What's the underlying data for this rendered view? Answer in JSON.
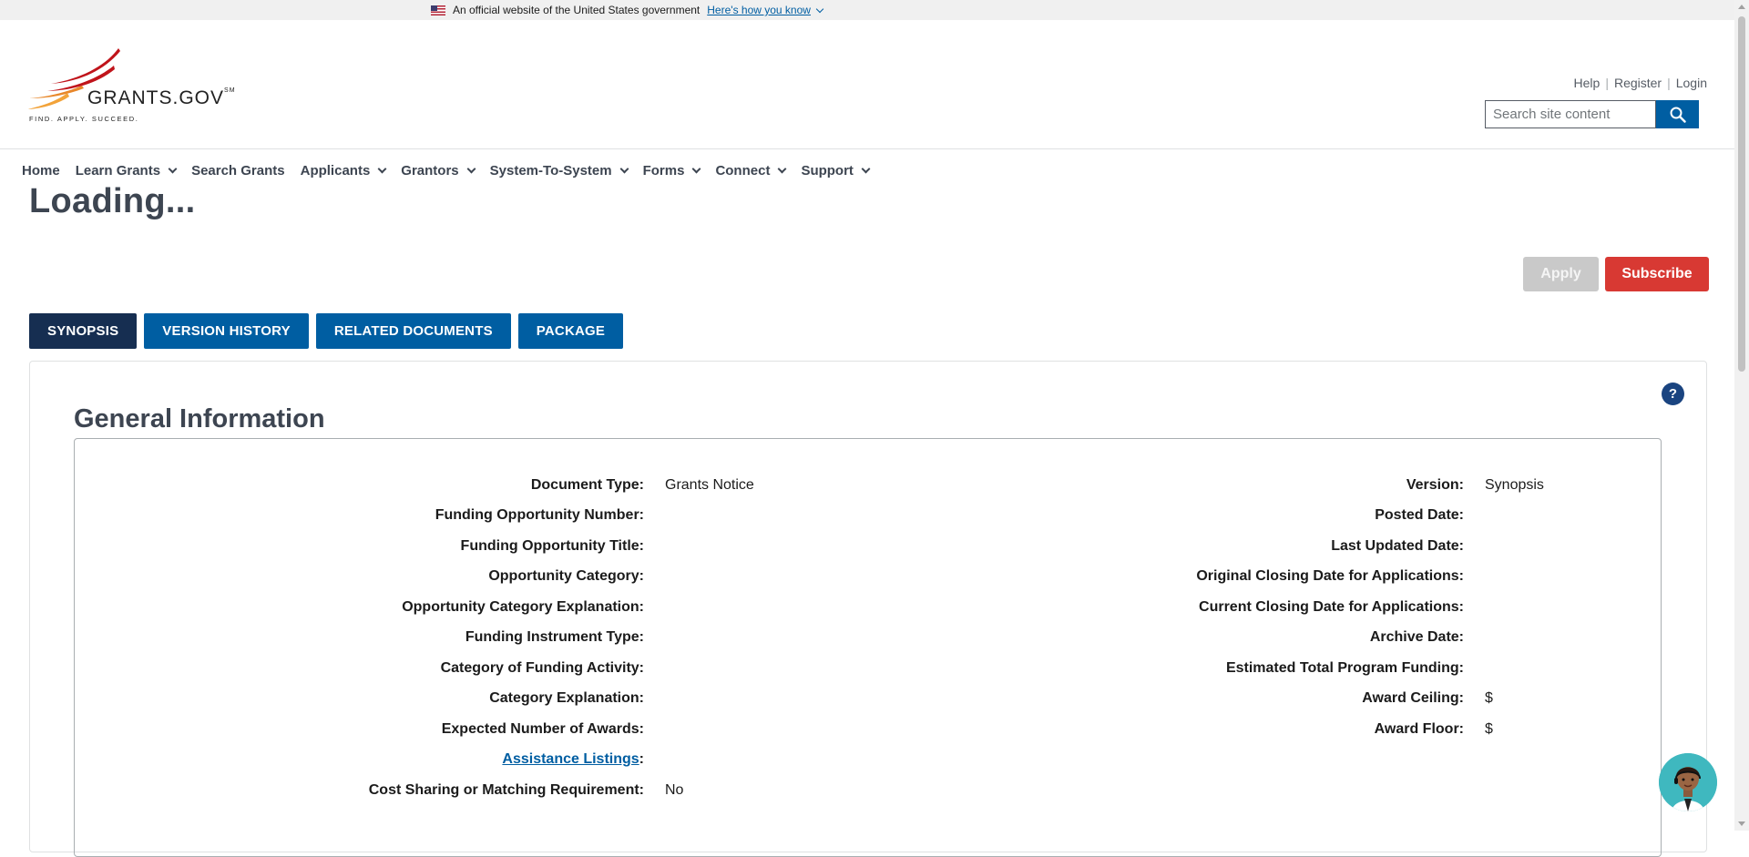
{
  "gov_banner": {
    "text": "An official website of the United States government",
    "link": "Here's how you know"
  },
  "logo": {
    "name": "GRANTS.GOV",
    "mark": "SM",
    "tagline": "FIND. APPLY. SUCCEED."
  },
  "utility": {
    "help": "Help",
    "sep": "|",
    "register": "Register",
    "login": "Login"
  },
  "search": {
    "placeholder": "Search site content",
    "value": ""
  },
  "nav": [
    {
      "label": "Home",
      "dropdown": false
    },
    {
      "label": "Learn Grants",
      "dropdown": true
    },
    {
      "label": "Search Grants",
      "dropdown": false
    },
    {
      "label": "Applicants",
      "dropdown": true
    },
    {
      "label": "Grantors",
      "dropdown": true
    },
    {
      "label": "System-To-System",
      "dropdown": true
    },
    {
      "label": "Forms",
      "dropdown": true
    },
    {
      "label": "Connect",
      "dropdown": true
    },
    {
      "label": "Support",
      "dropdown": true
    }
  ],
  "page_title": "Loading...",
  "actions": {
    "apply": "Apply",
    "subscribe": "Subscribe"
  },
  "tabs": [
    {
      "label": "SYNOPSIS",
      "active": true
    },
    {
      "label": "VERSION HISTORY",
      "active": false
    },
    {
      "label": "RELATED DOCUMENTS",
      "active": false
    },
    {
      "label": "PACKAGE",
      "active": false
    }
  ],
  "help_icon": "?",
  "general_info": {
    "title": "General Information",
    "left": [
      {
        "label": "Document Type:",
        "value": "Grants Notice"
      },
      {
        "label": "Funding Opportunity Number:",
        "value": ""
      },
      {
        "label": "Funding Opportunity Title:",
        "value": ""
      },
      {
        "label": "Opportunity Category:",
        "value": ""
      },
      {
        "label": "Opportunity Category Explanation:",
        "value": ""
      },
      {
        "label": "Funding Instrument Type:",
        "value": ""
      },
      {
        "label": "Category of Funding Activity:",
        "value": ""
      },
      {
        "label": "Category Explanation:",
        "value": ""
      },
      {
        "label": "Expected Number of Awards:",
        "value": ""
      },
      {
        "label": "Assistance Listings",
        "label_suffix": ":",
        "value": "",
        "link": true
      },
      {
        "label": "Cost Sharing or Matching Requirement:",
        "value": "No"
      }
    ],
    "right": [
      {
        "label": "Version:",
        "value": "Synopsis"
      },
      {
        "label": "Posted Date:",
        "value": ""
      },
      {
        "label": "Last Updated Date:",
        "value": ""
      },
      {
        "label": "Original Closing Date for Applications:",
        "value": ""
      },
      {
        "label": "Current Closing Date for Applications:",
        "value": ""
      },
      {
        "label": "Archive Date:",
        "value": ""
      },
      {
        "label": "Estimated Total Program Funding:",
        "value": ""
      },
      {
        "label": "Award Ceiling:",
        "value": "$"
      },
      {
        "label": "Award Floor:",
        "value": "$"
      }
    ]
  },
  "colors": {
    "primary": "#005ea2",
    "active_tab": "#162e51",
    "subscribe": "#d83933",
    "apply_disabled": "#c9c9c9",
    "logo_red": "#c0141b",
    "logo_orange": "#e8872a"
  }
}
